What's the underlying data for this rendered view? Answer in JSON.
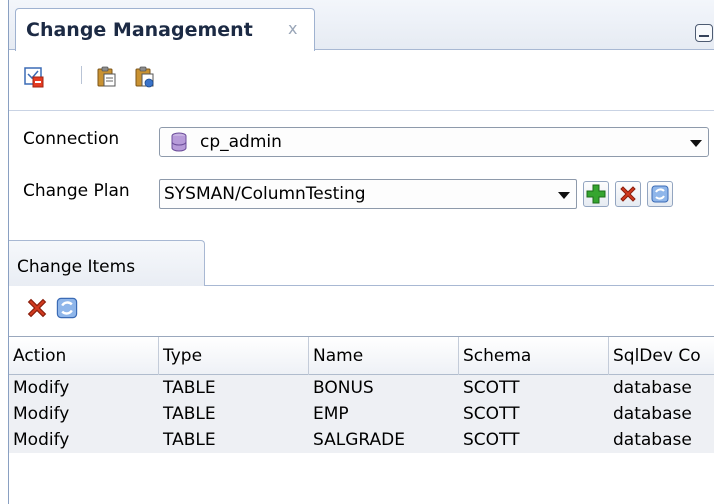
{
  "window": {
    "tab_title": "Change Management",
    "close_glyph": "x"
  },
  "toolbar": {
    "icons": [
      "new-change-icon",
      "paste-icon",
      "paste-special-icon"
    ]
  },
  "form": {
    "connection_label": "Connection",
    "connection_value": "cp_admin",
    "change_plan_label": "Change Plan",
    "change_plan_value": "SYSMAN/ColumnTesting"
  },
  "subtabs": {
    "active_label": "Change Items"
  },
  "table": {
    "columns": [
      "Action",
      "Type",
      "Name",
      "Schema",
      "SqlDev Co"
    ],
    "rows": [
      [
        "Modify",
        "TABLE",
        "BONUS",
        "SCOTT",
        "database"
      ],
      [
        "Modify",
        "TABLE",
        "EMP",
        "SCOTT",
        "database"
      ],
      [
        "Modify",
        "TABLE",
        "SALGRADE",
        "SCOTT",
        "database"
      ]
    ]
  },
  "colors": {
    "accent": "#3a73c9",
    "delete_red": "#d23a1f",
    "add_green": "#35a52f"
  }
}
